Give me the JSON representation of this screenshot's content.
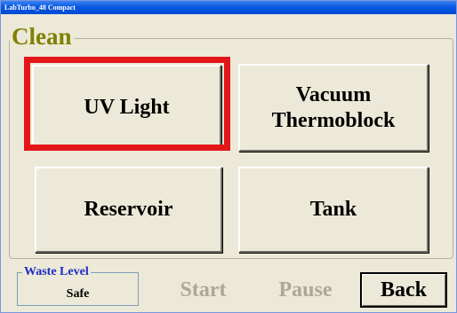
{
  "window": {
    "title": "LabTurbo_48 Compact"
  },
  "group": {
    "title": "Clean"
  },
  "buttons": [
    {
      "label": "UV Light"
    },
    {
      "label": "Vacuum\nThermoblock"
    },
    {
      "label": "Reservoir"
    },
    {
      "label": "Tank"
    }
  ],
  "highlight_color": "#e3161a",
  "waste": {
    "title": "Waste Level",
    "value": "Safe"
  },
  "footer": {
    "start_label": "Start",
    "pause_label": "Pause",
    "back_label": "Back"
  }
}
